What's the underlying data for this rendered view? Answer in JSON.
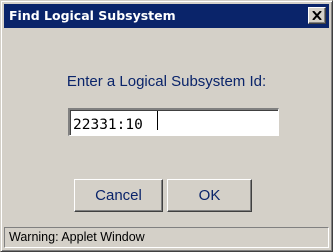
{
  "window": {
    "title": "Find Logical Subsystem",
    "close_icon": "close-icon"
  },
  "dialog": {
    "prompt": "Enter a Logical Subsystem Id:",
    "input_value": "22331:10"
  },
  "buttons": {
    "cancel_label": "Cancel",
    "ok_label": "OK"
  },
  "status": {
    "text": "Warning: Applet Window"
  },
  "colors": {
    "titlebar": "#0a246a",
    "face": "#d4d0c8",
    "label_text": "#0a246a"
  }
}
